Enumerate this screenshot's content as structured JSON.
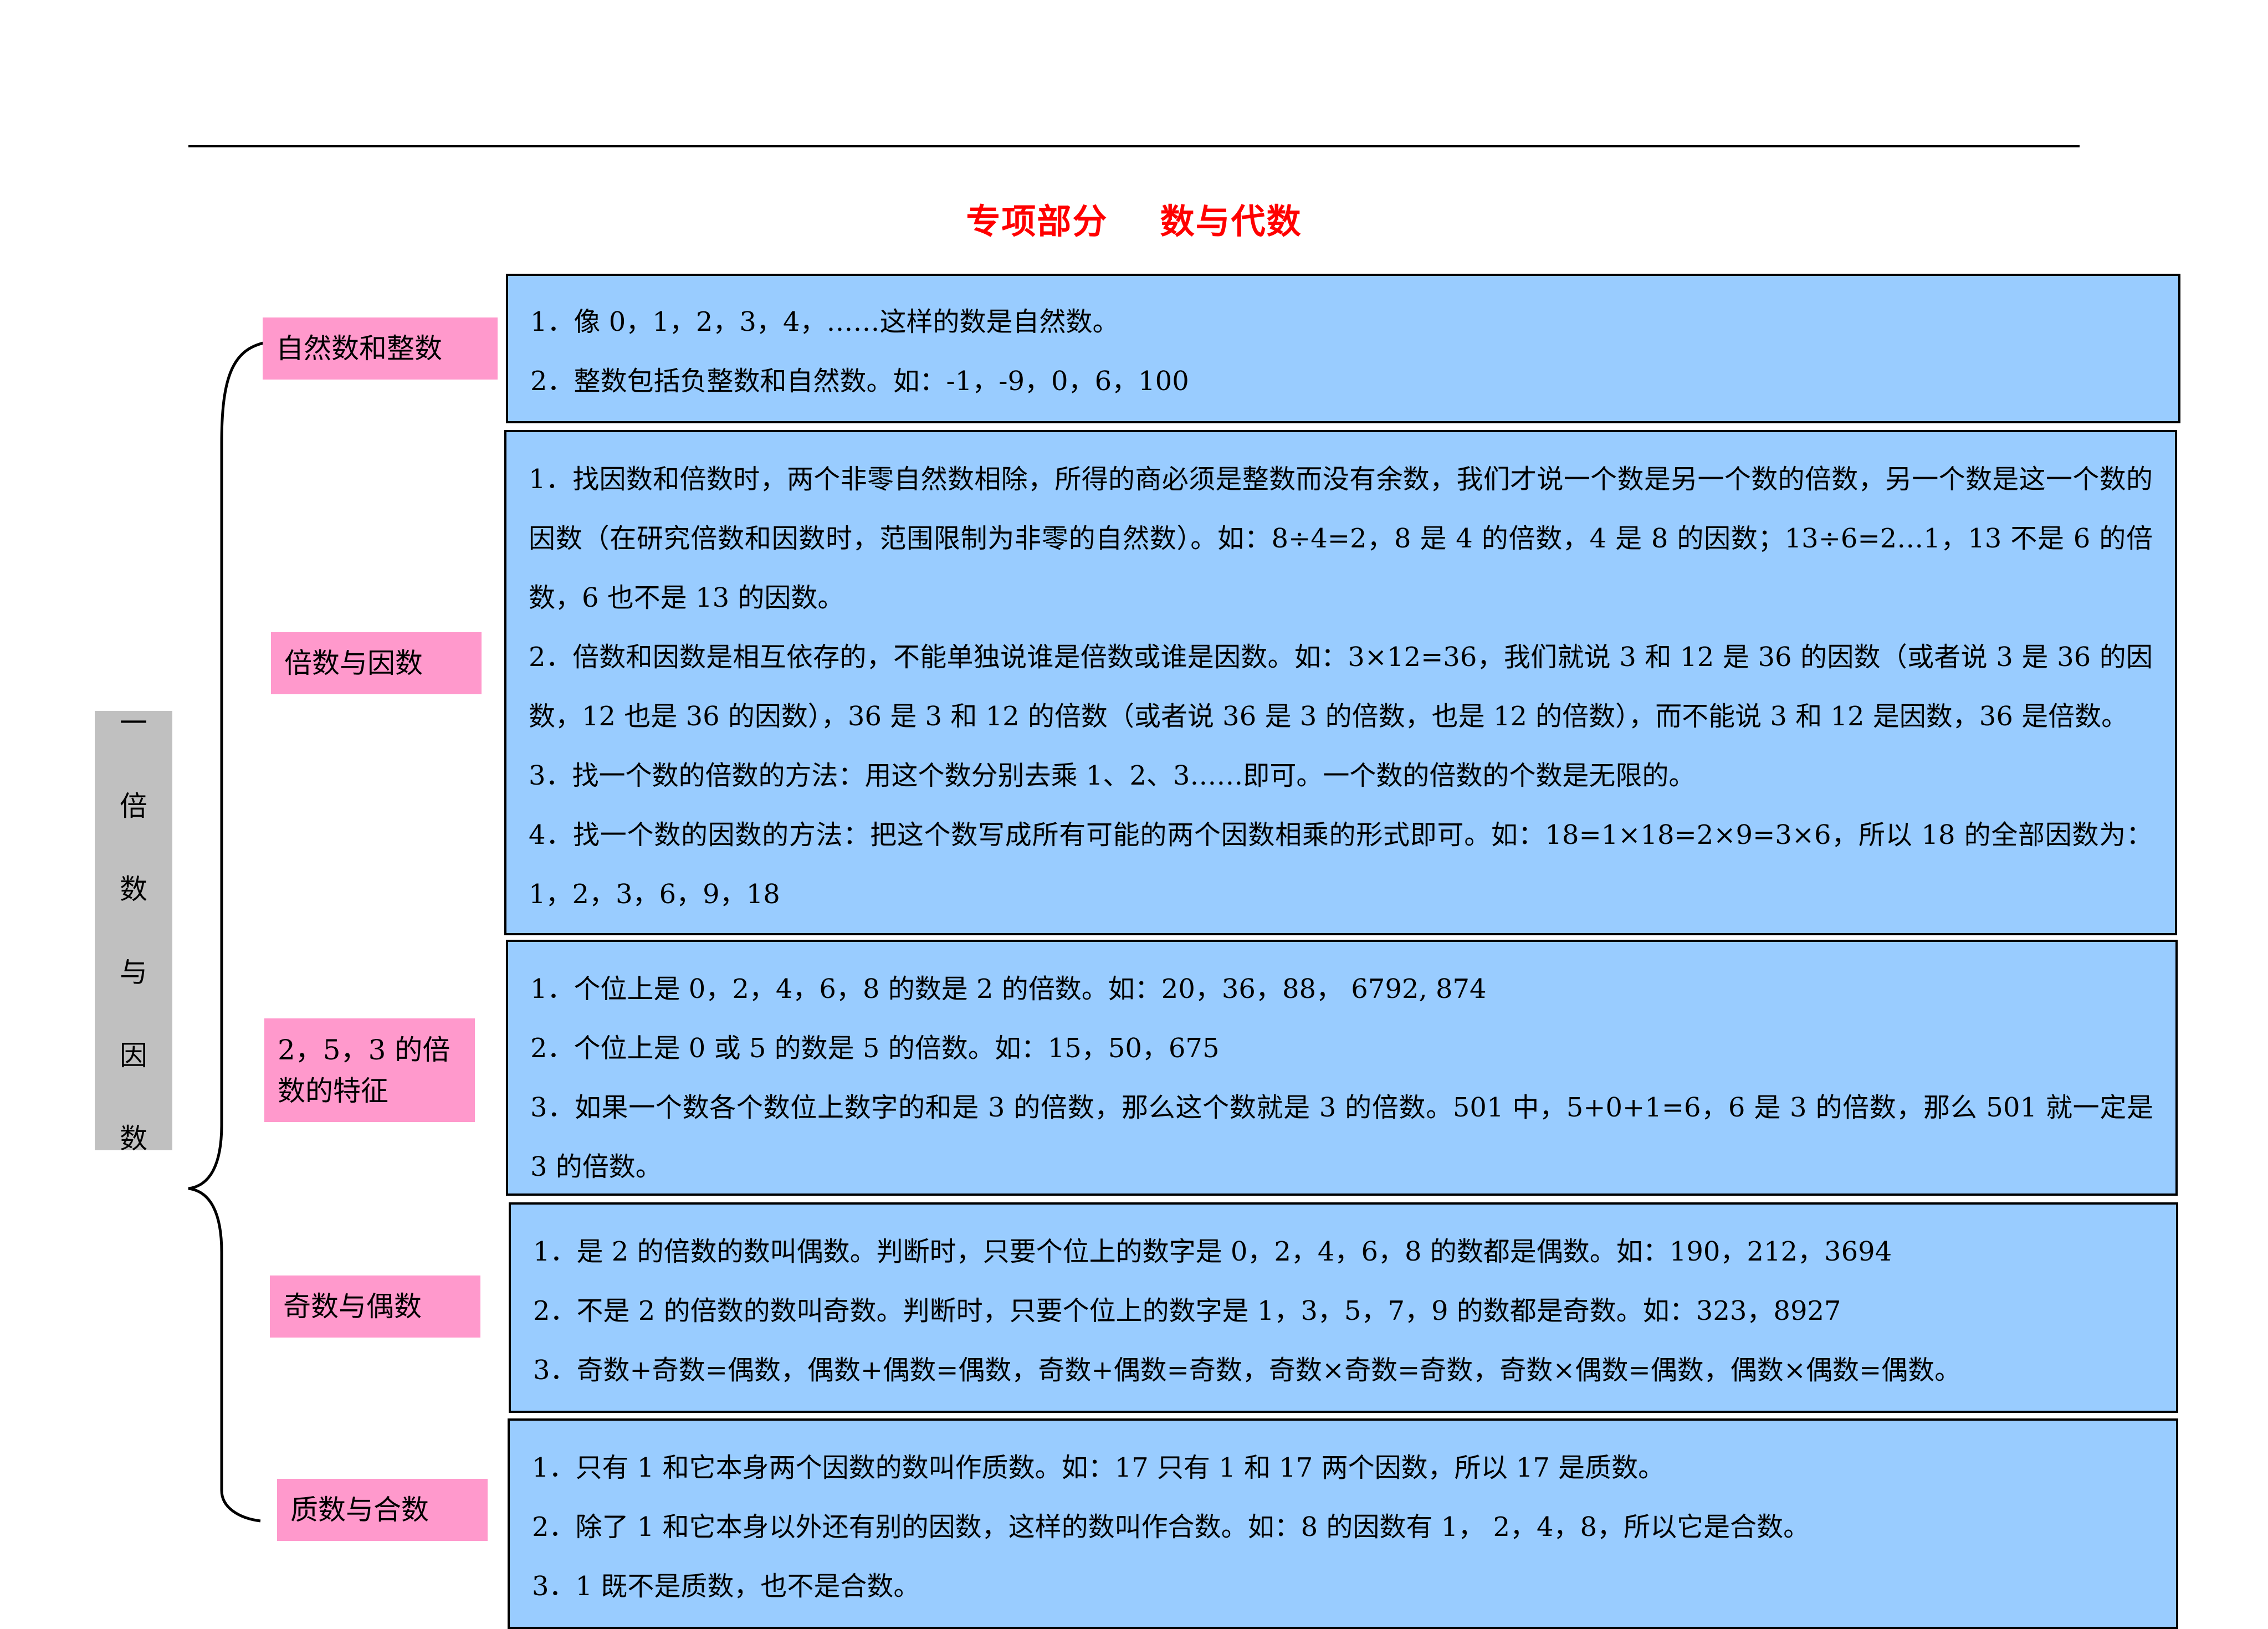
{
  "title": "专项部分    数与代数",
  "root": {
    "chars": [
      "一",
      "倍",
      "数",
      "与",
      "因",
      "数"
    ]
  },
  "sections": [
    {
      "label": "自然数和整数",
      "lines": [
        "1．像 0，1，2，3，4，……这样的数是自然数。",
        "2．整数包括负整数和自然数。如：-1，-9，0，6，100"
      ]
    },
    {
      "label": "倍数与因数",
      "lines": [
        "1．找因数和倍数时，两个非零自然数相除，所得的商必须是整数而没有余数，我们才说一个数是另一个数的倍数，另一个数是这一个数的因数（在研究倍数和因数时，范围限制为非零的自然数）。如：8÷4=2，8 是 4 的倍数，4 是 8 的因数；13÷6=2…1，13 不是 6 的倍数，6 也不是 13 的因数。",
        "2．倍数和因数是相互依存的，不能单独说谁是倍数或谁是因数。如：3×12=36，我们就说 3 和 12 是 36 的因数（或者说 3 是 36 的因数，12 也是 36 的因数），36 是 3 和 12 的倍数（或者说 36 是 3 的倍数，也是 12 的倍数），而不能说 3 和 12 是因数，36 是倍数。",
        "3．找一个数的倍数的方法：用这个数分别去乘 1、2、3……即可。一个数的倍数的个数是无限的。",
        "4．找一个数的因数的方法：把这个数写成所有可能的两个因数相乘的形式即可。如：18=1×18=2×9=3×6，所以 18 的全部因数为：1，2，3，6，9，18"
      ]
    },
    {
      "label": "2，5，3 的倍数的特征",
      "lines": [
        "1．个位上是 0，2，4，6，8 的数是 2 的倍数。如：20，36，88，  6792, 874",
        "2．个位上是 0 或 5 的数是 5 的倍数。如：15，50，675",
        "3．如果一个数各个数位上数字的和是 3 的倍数，那么这个数就是 3 的倍数。501 中，5+0+1=6，6 是 3 的倍数，那么 501 就一定是 3 的倍数。"
      ]
    },
    {
      "label": "奇数与偶数",
      "lines": [
        "1．是 2 的倍数的数叫偶数。判断时，只要个位上的数字是 0，2，4，6，8 的数都是偶数。如：190，212，3694",
        "2．不是 2 的倍数的数叫奇数。判断时，只要个位上的数字是 1，3，5，7，9 的数都是奇数。如：323，8927",
        "3．奇数+奇数=偶数，偶数+偶数=偶数，奇数+偶数=奇数，奇数×奇数=奇数，奇数×偶数=偶数，偶数×偶数=偶数。"
      ]
    },
    {
      "label": "质数与合数",
      "lines": [
        "1．只有 1 和它本身两个因数的数叫作质数。如：17 只有 1 和 17 两个因数，所以 17 是质数。",
        "2．除了 1 和它本身以外还有别的因数，这样的数叫作合数。如：8 的因数有 1，  2，4，8，所以它是合数。",
        "3．1 既不是质数，也不是合数。"
      ]
    }
  ]
}
